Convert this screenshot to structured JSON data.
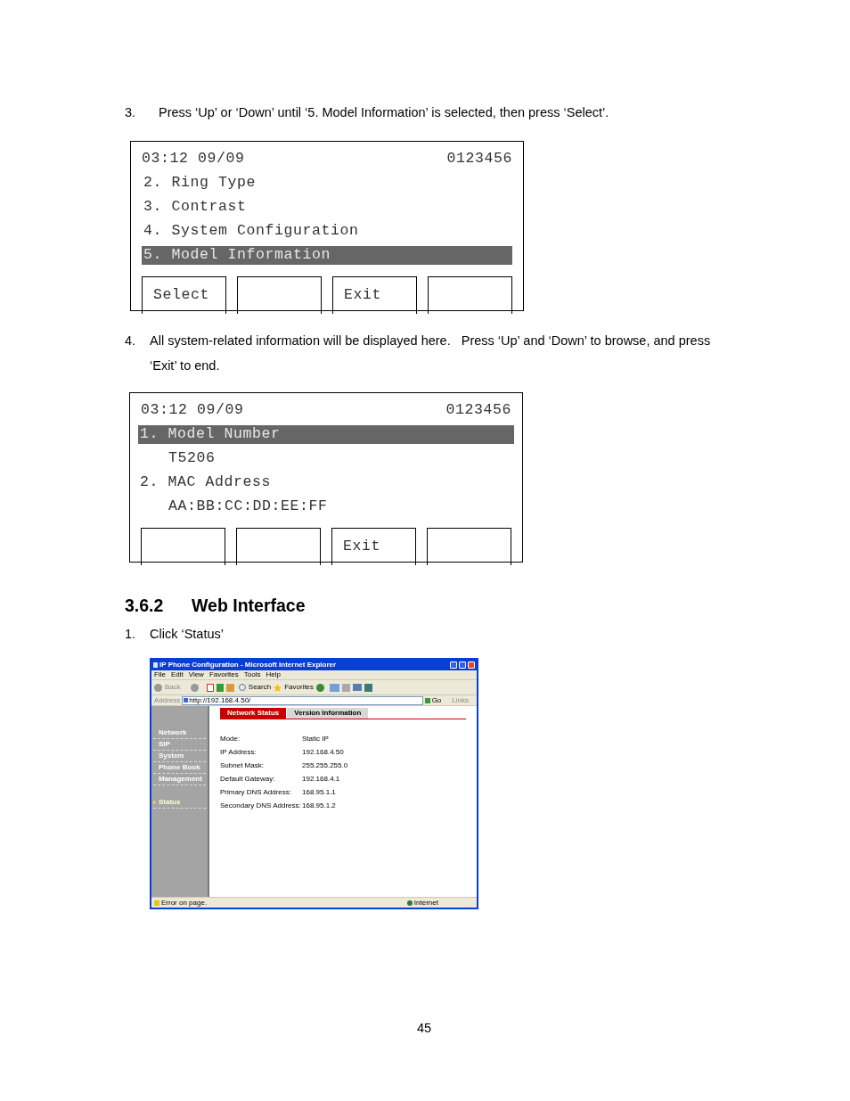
{
  "steps": [
    {
      "number": "3.",
      "text": "Press ‘Up’ or ‘Down’ until ‘5. Model Information’ is selected, then press ‘Select’."
    }
  ],
  "screen_1": {
    "time": "03:12 09/09",
    "number": "0123456",
    "rows": [
      {
        "kind": "item",
        "text": "2. Ring Type",
        "selected": false
      },
      {
        "kind": "item",
        "text": "3. Contrast",
        "selected": false
      },
      {
        "kind": "item",
        "text": "4. System Configuration",
        "selected": false
      },
      {
        "kind": "item",
        "text": "5. Model Information",
        "selected": true
      }
    ],
    "softkeys": [
      {
        "kind": "labeled",
        "label": "Select"
      },
      {
        "kind": "blank"
      },
      {
        "kind": "labeled",
        "label": "Exit"
      },
      {
        "kind": "blank"
      }
    ]
  },
  "step_4": {
    "number": "4.",
    "text": "All system-related information will be displayed here.   Press ‘Up’ and ‘Down’ to browse, and press ‘Exit’ to end."
  },
  "screen_2": {
    "time": "03:12 09/09",
    "number": "0123456",
    "rows": [
      {
        "kind": "item",
        "text": "1. Model Number",
        "selected": true
      },
      {
        "kind": "value",
        "text": "T5206",
        "selected": false
      },
      {
        "kind": "item",
        "text": "2. MAC Address",
        "selected": false
      },
      {
        "kind": "value",
        "text": "AA:BB:CC:DD:EE:FF",
        "selected": false
      }
    ],
    "softkeys": [
      {
        "kind": "blank"
      },
      {
        "kind": "blank"
      },
      {
        "kind": "labeled",
        "label": "Exit"
      },
      {
        "kind": "blank"
      }
    ]
  },
  "section": {
    "number": "3.6.2",
    "title": "Web Interface"
  },
  "step_1": {
    "number": "1.",
    "text": "Click ‘Status’"
  },
  "browser": {
    "title": "IP Phone Configuration - Microsoft Internet Explorer",
    "menu": [
      "File",
      "Edit",
      "View",
      "Favorites",
      "Tools",
      "Help"
    ],
    "toolbar": {
      "back": "Back",
      "search": "Search",
      "favorites": "Favorites"
    },
    "address": {
      "label": "Address",
      "url": "http://192.168.4.50/",
      "go": "Go",
      "links": "Links"
    },
    "tabs": [
      {
        "label": "Network Status",
        "selected": true
      },
      {
        "label": "Version Information",
        "selected": false
      }
    ],
    "sidebar": [
      {
        "label": "Network",
        "selected": false
      },
      {
        "label": "SIP",
        "selected": false
      },
      {
        "label": "System",
        "selected": false
      },
      {
        "label": "Phone Book",
        "selected": false
      },
      {
        "label": "Management",
        "selected": false
      },
      {
        "label": "Status",
        "selected": true
      }
    ],
    "fields": [
      {
        "label": "Mode:",
        "value": "Static IP"
      },
      {
        "label": "IP Address:",
        "value": "192.168.4.50"
      },
      {
        "label": "Subnet Mask:",
        "value": "255.255.255.0"
      },
      {
        "label": "Default Gateway:",
        "value": "192.168.4.1"
      },
      {
        "label": "Primary DNS Address:",
        "value": "168.95.1.1"
      },
      {
        "label": "Secondary DNS Address:",
        "value": "168.95.1.2"
      }
    ],
    "status_bar": {
      "message": "Error on page.",
      "zone": "Internet"
    }
  },
  "page_number": "45"
}
